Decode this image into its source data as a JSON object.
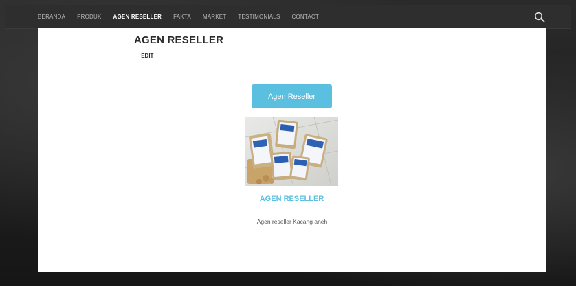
{
  "nav": {
    "items": [
      {
        "label": "BERANDA",
        "active": false
      },
      {
        "label": "PRODUK",
        "active": false
      },
      {
        "label": "AGEN RESELLER",
        "active": true
      },
      {
        "label": "FAKTA",
        "active": false
      },
      {
        "label": "MARKET",
        "active": false
      },
      {
        "label": "TESTIMONIALS",
        "active": false
      },
      {
        "label": "CONTACT",
        "active": false
      }
    ],
    "search_icon": "search-icon"
  },
  "page": {
    "title": "AGEN RESELLER",
    "edit_label": "— EDIT"
  },
  "feature": {
    "button_label": "Agen Reseller",
    "image_icon": "product-photo",
    "title": "AGEN RESELLER",
    "description": "Agen reseller Kacang aneh"
  },
  "colors": {
    "accent": "#5bbfdf",
    "nav_bg": "#2e2e2e",
    "page_bg": "#1b1b1b",
    "content_bg": "#ffffff"
  }
}
